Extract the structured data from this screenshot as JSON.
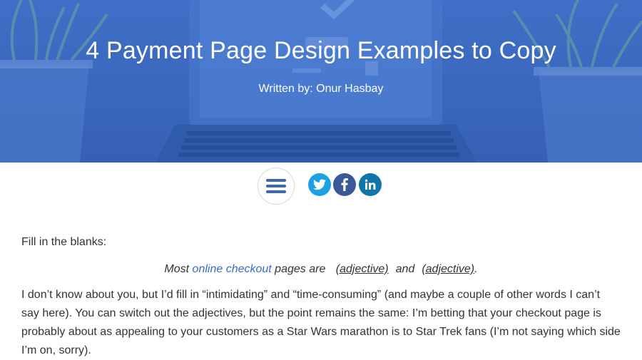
{
  "hero": {
    "title": "4 Payment Page Design Examples to Copy",
    "author_line": "Written by: Onur Hasbay",
    "background_colors": [
      "#3f6fc6",
      "#3660b4"
    ]
  },
  "share": {
    "menu_icon": "hamburger-icon",
    "twitter": {
      "icon": "twitter-icon",
      "color": "#1da1e2"
    },
    "facebook": {
      "icon": "facebook-icon",
      "color": "#3b5998"
    },
    "linkedin": {
      "icon": "linkedin-icon",
      "color": "#0e76a8"
    }
  },
  "article": {
    "intro": "Fill in the blanks:",
    "prompt": {
      "prefix": "Most ",
      "link_text": "online checkout",
      "middle": " pages are ",
      "blank1": "(adjective)",
      "and_word": "and",
      "blank2": "(adjective)",
      "suffix": "."
    },
    "paragraph": "I don’t know about you, but I’d fill in “intimidating” and “time-consuming” (and maybe a couple of other words I can’t say here). You can switch out the adjectives, but the point remains the same: I’m betting that your checkout page is probably about as appealing to your customers as a Star Wars marathon is to Star Trek fans (I’m not saying which side I’m on, sorry).",
    "link_color": "#3a6bc4"
  }
}
